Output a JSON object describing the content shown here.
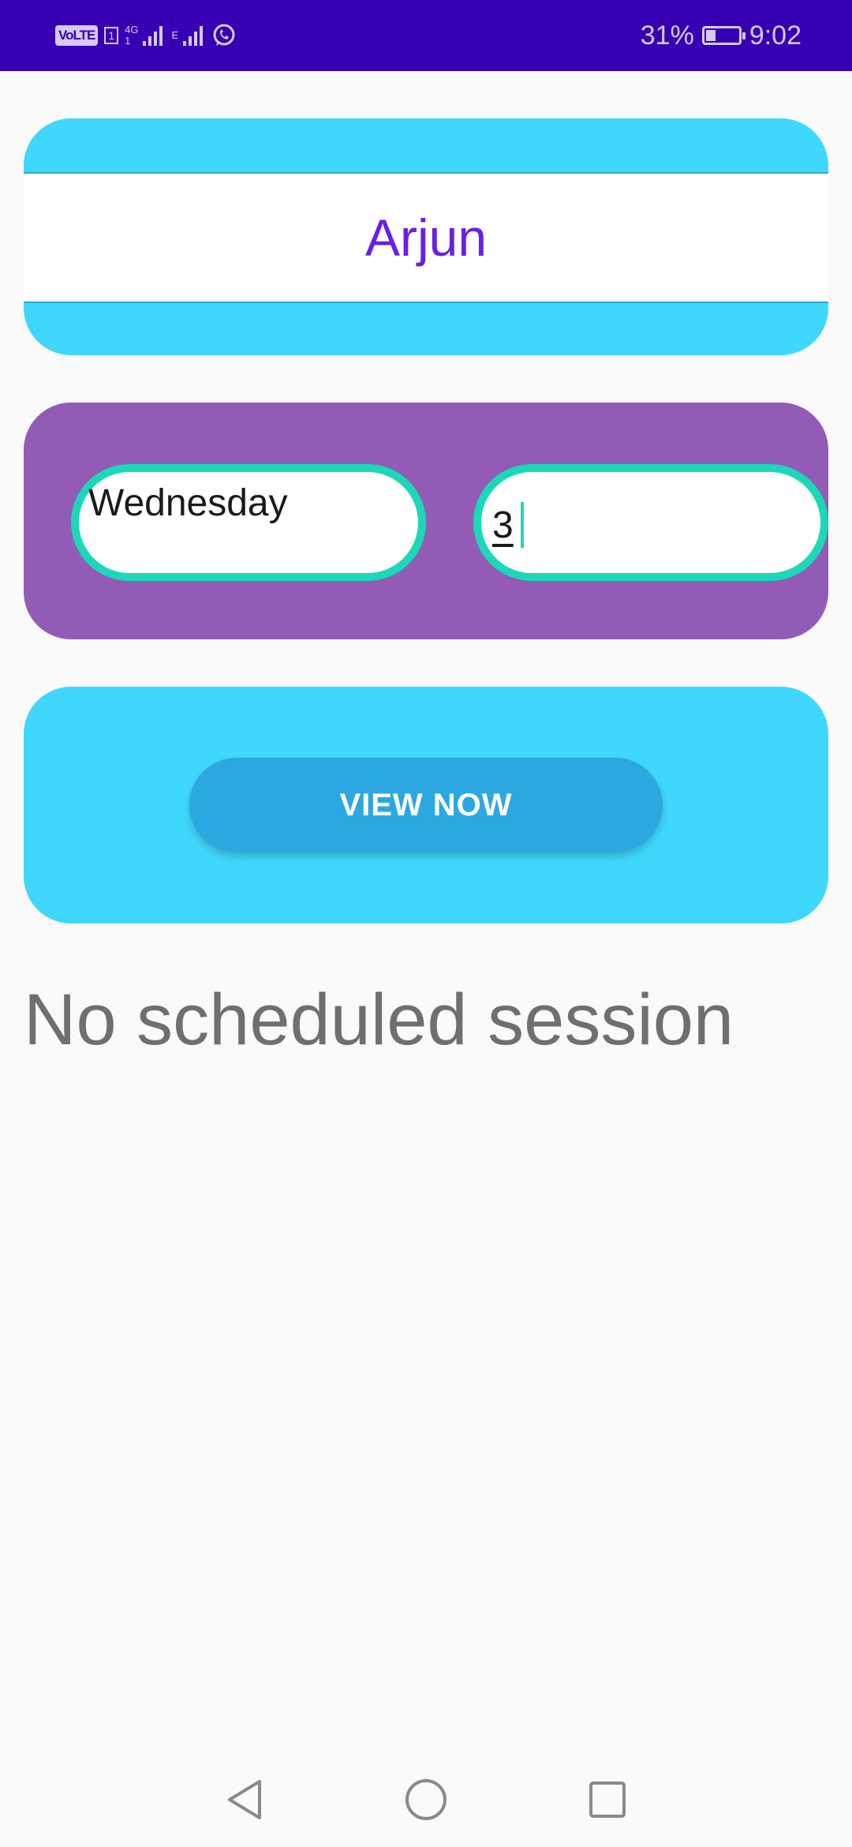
{
  "status_bar": {
    "volte_label": "VoLTE",
    "sim_slot": "1",
    "net_top": "4G",
    "net_bottom": "1",
    "net2": "E",
    "battery_percent_text": "31%",
    "battery_level": 0.31,
    "time": "9:02",
    "icons": [
      "volte-icon",
      "signal-icon",
      "signal-icon",
      "whatsapp-icon",
      "battery-icon"
    ]
  },
  "profile": {
    "name": "Arjun"
  },
  "inputs": {
    "day_value": "Wednesday",
    "number_value": "3"
  },
  "actions": {
    "view_label": "VIEW NOW"
  },
  "result": {
    "message": "No scheduled session"
  },
  "nav": {
    "icons": [
      "back-icon",
      "home-icon",
      "recents-icon"
    ]
  },
  "colors": {
    "status_bar": "#3700b3",
    "card_blue": "#3fd8fc",
    "card_purple": "#925cb6",
    "input_border": "#1bd8b8",
    "button": "#2ca8e1",
    "name_text": "#6a1fe6"
  }
}
